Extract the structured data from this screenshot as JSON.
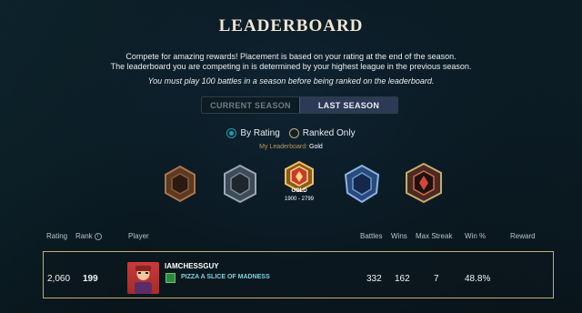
{
  "header": {
    "title": "LEADERBOARD",
    "desc_line1": "Compete for amazing rewards! Placement is based on your rating at the end of the season.",
    "desc_line2": "The leaderboard you are competing in is determined by your highest league in the previous season.",
    "requirement": "You must play 100 battles in a season before being ranked on the leaderboard."
  },
  "season_tabs": [
    {
      "label": "CURRENT SEASON",
      "active": false
    },
    {
      "label": "LAST SEASON",
      "active": true
    }
  ],
  "filters": {
    "by_rating": {
      "label": "By Rating",
      "selected": true
    },
    "ranked_only": {
      "label": "Ranked Only",
      "selected": false
    }
  },
  "my_league": {
    "label": "My Leaderboard:",
    "value": "Gold"
  },
  "leagues": {
    "selected_name": "GOLD",
    "selected_range": "1900 - 2799"
  },
  "table": {
    "headers": {
      "rating": "Rating",
      "rank": "Rank",
      "player": "Player",
      "battles": "Battles",
      "wins": "Wins",
      "max_streak": "Max Streak",
      "win_pct": "Win %",
      "reward": "Reward"
    },
    "rows": [
      {
        "rating": "2,060",
        "rank": "199",
        "player": "IAMCHESSGUY",
        "clan": "PIZZA A SLICE OF MADNESS",
        "battles": "332",
        "wins": "162",
        "max_streak": "7",
        "win_pct": "48.8%"
      }
    ]
  },
  "colors": {
    "accent_gold": "#c8aa6e",
    "active_tab": "#2c3a55",
    "teal": "#1f9fb0"
  }
}
